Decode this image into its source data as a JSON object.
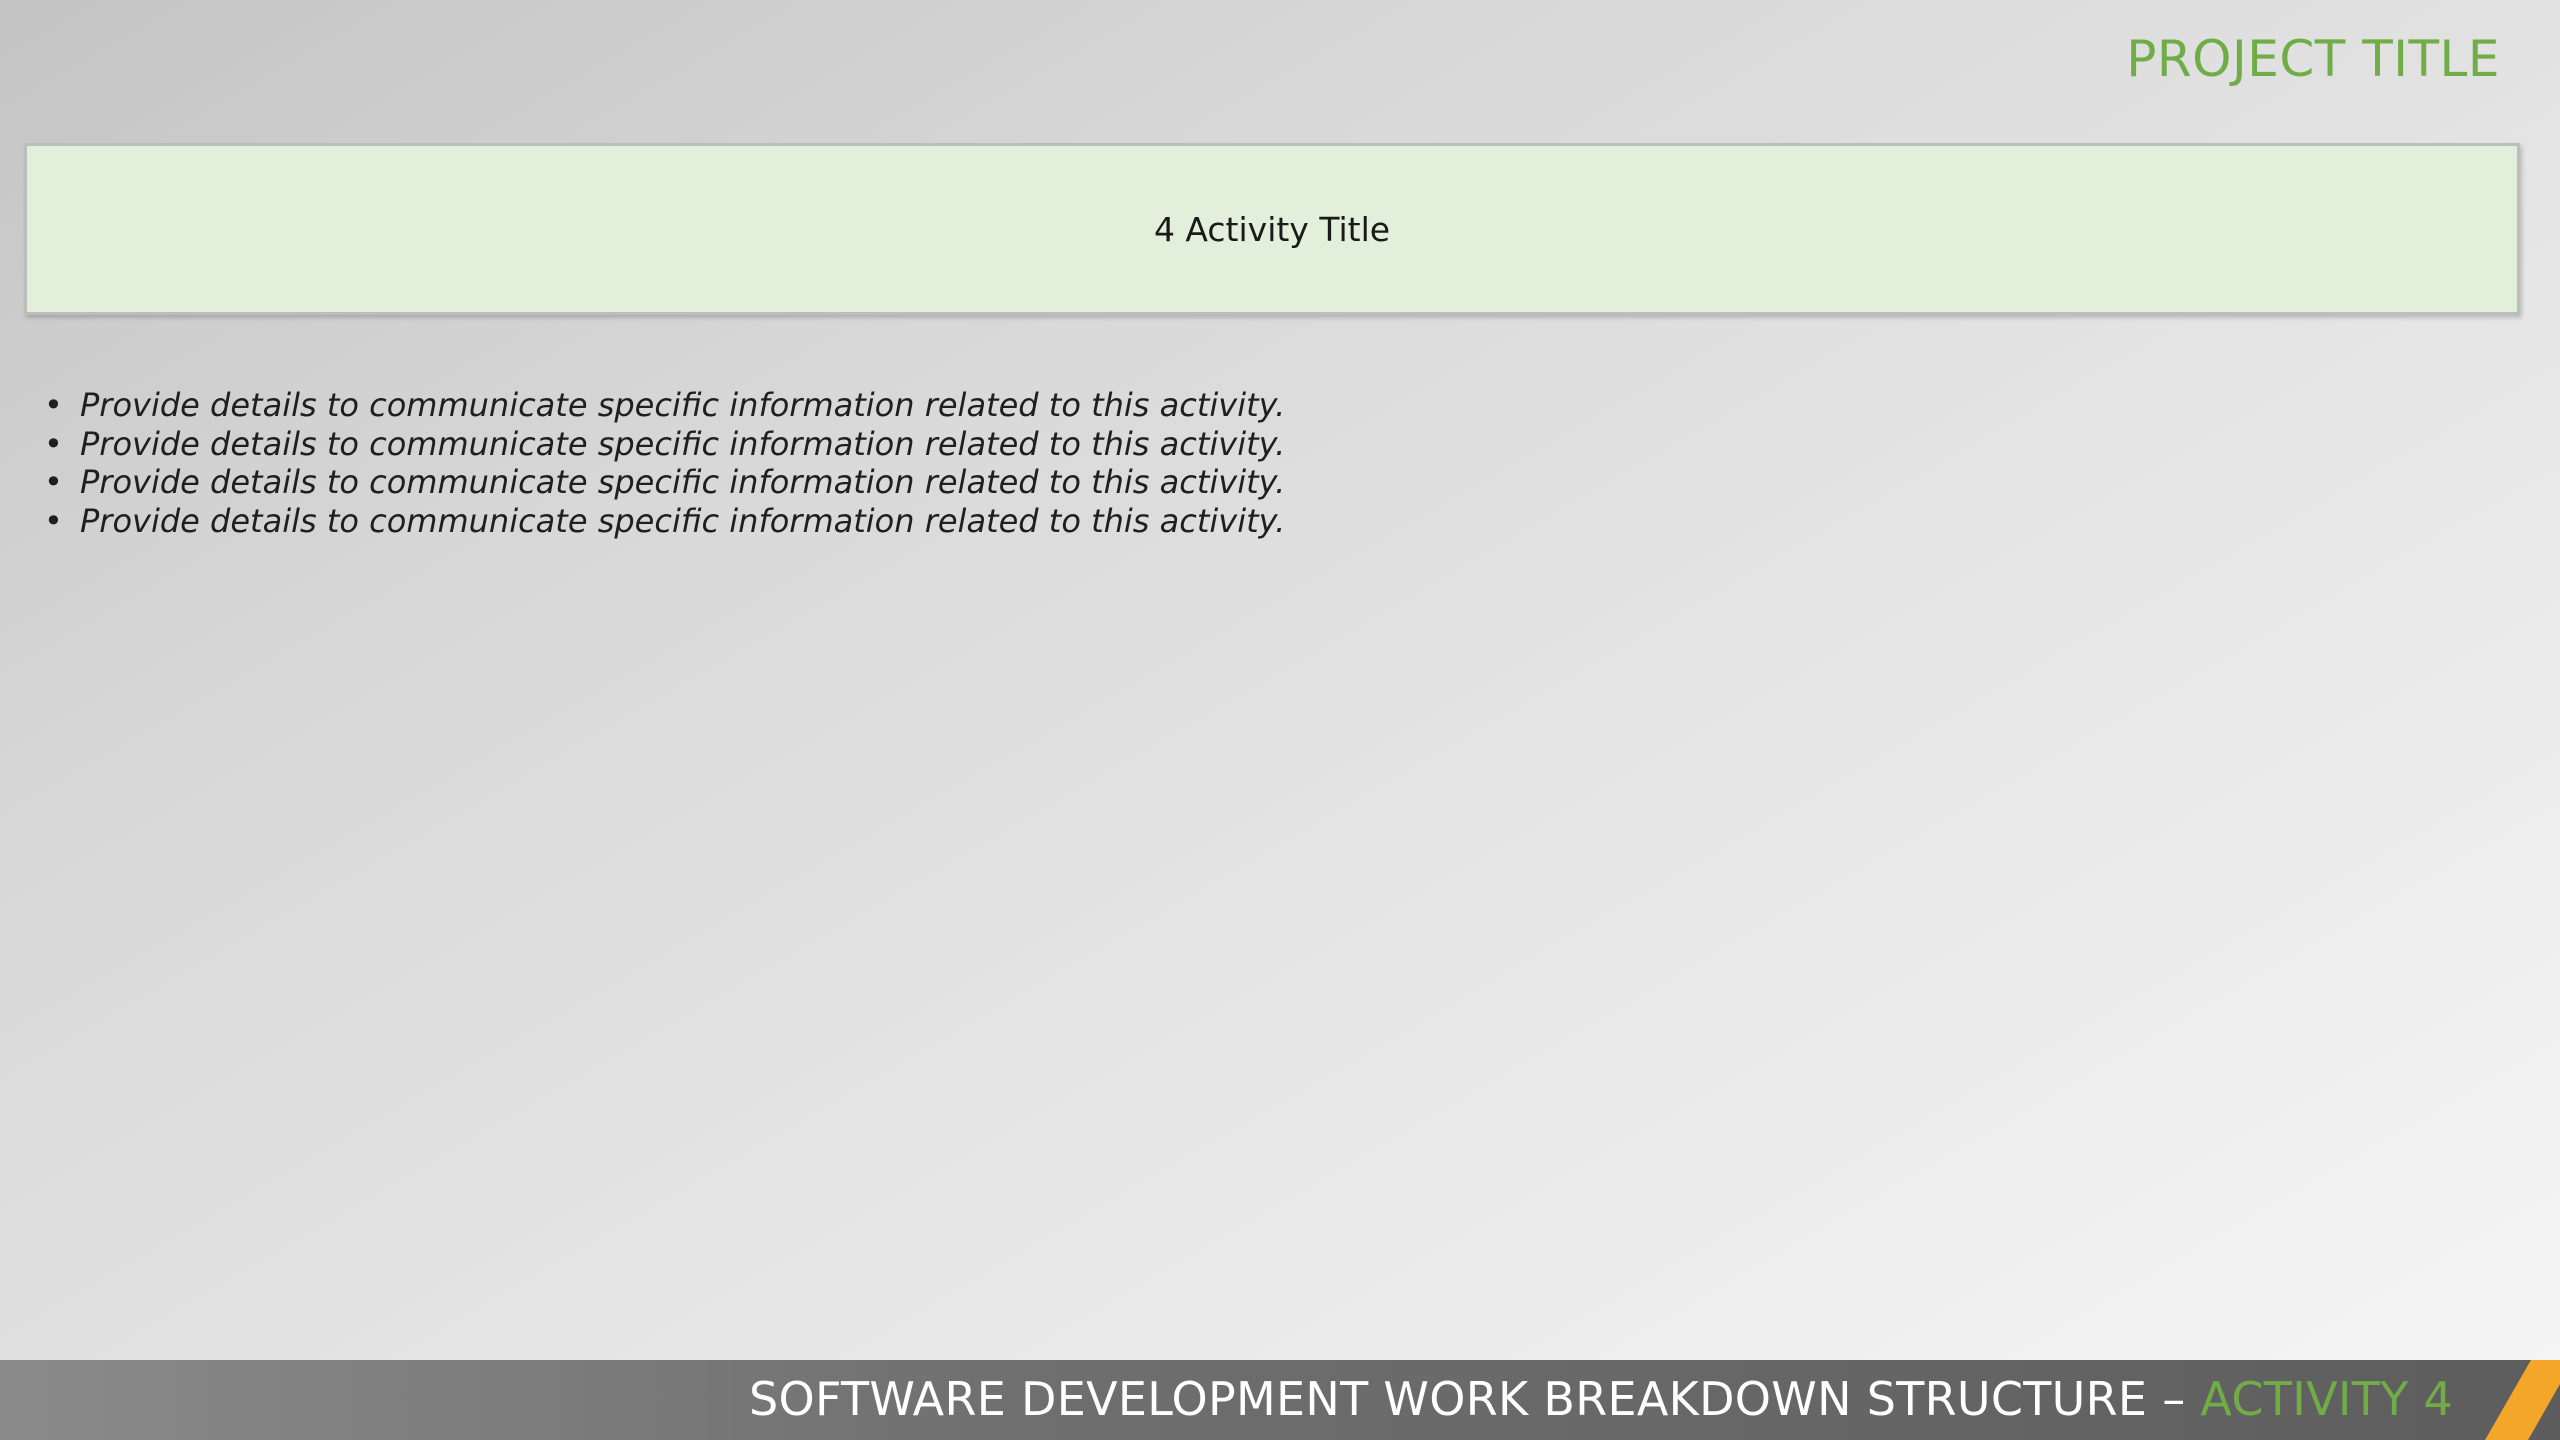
{
  "header": {
    "project_title": "PROJECT TITLE"
  },
  "activity": {
    "title": "4 Activity Title",
    "bullets": [
      "Provide details to communicate specific information related to this activity.",
      "Provide details to communicate specific information related to this activity.",
      "Provide details to communicate specific information related to this activity.",
      "Provide details to communicate specific information related to this activity."
    ],
    "bullet_glyph": "•"
  },
  "footer": {
    "main_text": "SOFTWARE DEVELOPMENT WORK BREAKDOWN STRUCTURE",
    "separator": " – ",
    "accent_text": "ACTIVITY 4"
  },
  "colors": {
    "accent_green": "#70AD47",
    "box_fill": "#E2EFDA",
    "stripe_orange": "#F4A62A"
  }
}
